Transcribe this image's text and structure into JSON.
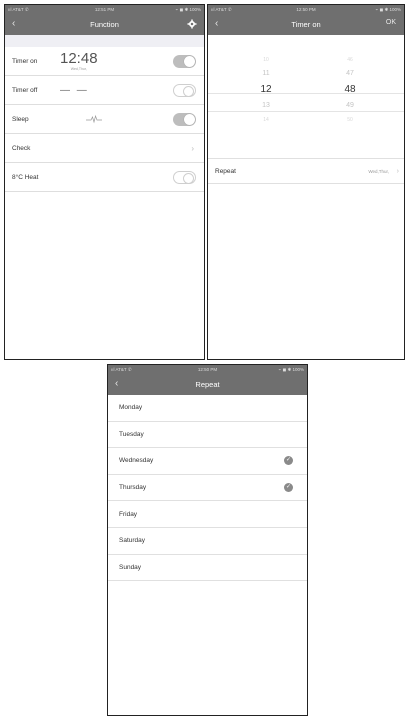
{
  "screens": {
    "function": {
      "status": {
        "carrier": "ııl AT&T ✆",
        "time": "12:51 PM",
        "right": "⌁ ◼ ✱ 100%"
      },
      "title": "Function",
      "icons": {
        "back": "chevron-left-icon",
        "settings": "gear-icon"
      },
      "rows": [
        {
          "label": "Timer on",
          "time": "12:48",
          "days": "Wed,Thur,",
          "toggle": "on"
        },
        {
          "label": "Timer off",
          "dashes": "— —",
          "toggle": "off"
        },
        {
          "label": "Sleep",
          "icon": "sleep-curve-icon",
          "toggle": "on"
        },
        {
          "label": "Check",
          "icon": "chevron-right-icon"
        },
        {
          "label": "8°C Heat",
          "toggle": "off"
        }
      ]
    },
    "timer_on": {
      "status": {
        "carrier": "ııl AT&T ✆",
        "time": "12:50 PM",
        "right": "⌁ ◼ ✱ 100%"
      },
      "title": "Timer on",
      "ok_label": "OK",
      "hours": [
        "10",
        "11",
        "12",
        "13",
        "14"
      ],
      "minutes": [
        "46",
        "47",
        "48",
        "49",
        "50"
      ],
      "selected": {
        "hour": "12",
        "minute": "48"
      },
      "repeat": {
        "label": "Repeat",
        "value": "Wed,Thur,"
      }
    },
    "repeat": {
      "status": {
        "carrier": "ııl AT&T ✆",
        "time": "12:50 PM",
        "right": "⌁ ◼ ✱ 100%"
      },
      "title": "Repeat",
      "days": [
        {
          "name": "Monday",
          "checked": false
        },
        {
          "name": "Tuesday",
          "checked": false
        },
        {
          "name": "Wednesday",
          "checked": true
        },
        {
          "name": "Thursday",
          "checked": true
        },
        {
          "name": "Friday",
          "checked": false
        },
        {
          "name": "Saturday",
          "checked": false
        },
        {
          "name": "Sunday",
          "checked": false
        }
      ]
    }
  },
  "colors": {
    "navbar": "#6f6f6f",
    "background": "#ffffff",
    "separator": "#efeff4",
    "toggle_on": "#bdbdbd"
  }
}
